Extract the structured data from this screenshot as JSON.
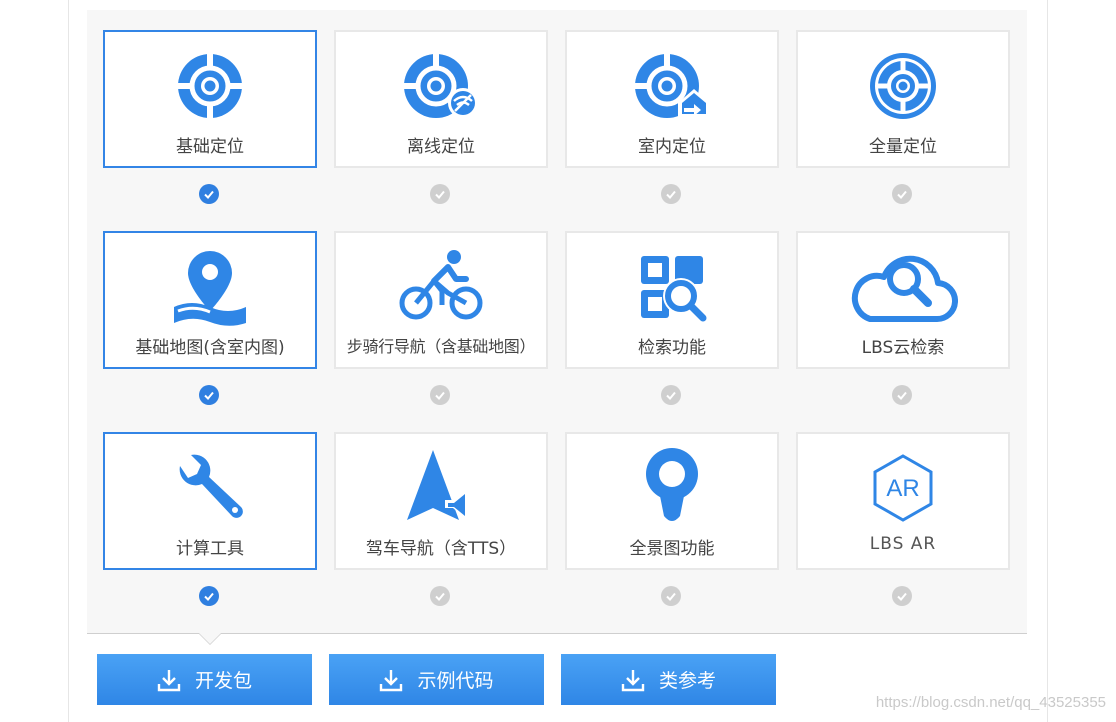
{
  "colors": {
    "accent": "#3385e6",
    "icon": "#2f86e6",
    "check_off": "#cfcfcf"
  },
  "cards": [
    {
      "label": "基础定位",
      "icon": "locate-icon",
      "selected": true
    },
    {
      "label": "离线定位",
      "icon": "offline-locate-icon",
      "selected": false
    },
    {
      "label": "室内定位",
      "icon": "indoor-locate-icon",
      "selected": false
    },
    {
      "label": "全量定位",
      "icon": "full-locate-icon",
      "selected": false
    },
    {
      "label": "基础地图(含室内图)",
      "icon": "map-pin-icon",
      "selected": true
    },
    {
      "label": "步骑行导航（含基础地图）",
      "icon": "cycling-icon",
      "selected": false
    },
    {
      "label": "检索功能",
      "icon": "search-feature-icon",
      "selected": false
    },
    {
      "label": "LBS云检索",
      "icon": "cloud-search-icon",
      "selected": false
    },
    {
      "label": "计算工具",
      "icon": "wrench-icon",
      "selected": true
    },
    {
      "label": "驾车导航（含TTS）",
      "icon": "drive-nav-icon",
      "selected": false
    },
    {
      "label": "全景图功能",
      "icon": "panorama-icon",
      "selected": false
    },
    {
      "label": "LBS AR",
      "icon": "ar-icon",
      "selected": false,
      "badge": "AR"
    }
  ],
  "buttons": [
    {
      "label": "开发包",
      "icon": "download-icon"
    },
    {
      "label": "示例代码",
      "icon": "download-icon"
    },
    {
      "label": "类参考",
      "icon": "download-icon"
    }
  ],
  "watermark": "https://blog.csdn.net/qq_43525355"
}
